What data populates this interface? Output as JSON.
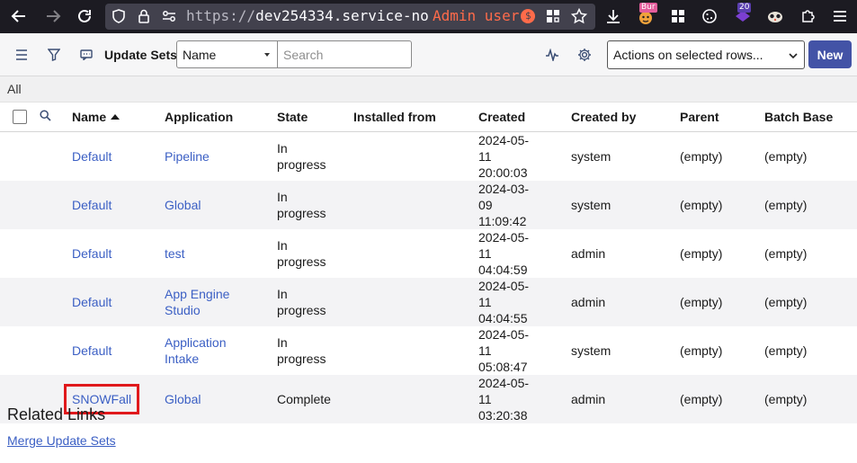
{
  "browser": {
    "url_prefix": "https://",
    "url_host": "dev254334.service-no",
    "container_label": "Admin user",
    "container_badge": "$",
    "ext_badge_1": "Bur",
    "ext_badge_2": "20"
  },
  "header": {
    "title": "Update Sets",
    "field_select_value": "Name",
    "search_placeholder": "Search",
    "actions_select_value": "Actions on selected rows...",
    "new_label": "New"
  },
  "breadcrumb": "All",
  "table": {
    "columns": [
      "Name",
      "Application",
      "State",
      "Installed from",
      "Created",
      "Created by",
      "Parent",
      "Batch Base"
    ],
    "rows": [
      {
        "name": "Default",
        "application": "Pipeline",
        "state": "In progress",
        "installed_from": "",
        "created": "2024-05-11 20:00:03",
        "created_by": "system",
        "parent": "(empty)",
        "batch_base": "(empty)"
      },
      {
        "name": "Default",
        "application": "Global",
        "state": "In progress",
        "installed_from": "",
        "created": "2024-03-09 11:09:42",
        "created_by": "system",
        "parent": "(empty)",
        "batch_base": "(empty)"
      },
      {
        "name": "Default",
        "application": "test",
        "state": "In progress",
        "installed_from": "",
        "created": "2024-05-11 04:04:59",
        "created_by": "admin",
        "parent": "(empty)",
        "batch_base": "(empty)"
      },
      {
        "name": "Default",
        "application": "App Engine Studio",
        "state": "In progress",
        "installed_from": "",
        "created": "2024-05-11 04:04:55",
        "created_by": "admin",
        "parent": "(empty)",
        "batch_base": "(empty)"
      },
      {
        "name": "Default",
        "application": "Application Intake",
        "state": "In progress",
        "installed_from": "",
        "created": "2024-05-11 05:08:47",
        "created_by": "system",
        "parent": "(empty)",
        "batch_base": "(empty)"
      },
      {
        "name": "SNOWFall",
        "application": "Global",
        "state": "Complete",
        "installed_from": "",
        "created": "2024-05-11 03:20:38",
        "created_by": "admin",
        "parent": "(empty)",
        "batch_base": "(empty)"
      }
    ]
  },
  "related": {
    "title": "Related Links",
    "merge_label": "Merge Update Sets"
  },
  "colors": {
    "primary_button": "#4353a6",
    "link": "#3b5fc4",
    "highlight": "#e0191c",
    "browser_chrome": "#1c1b22"
  }
}
